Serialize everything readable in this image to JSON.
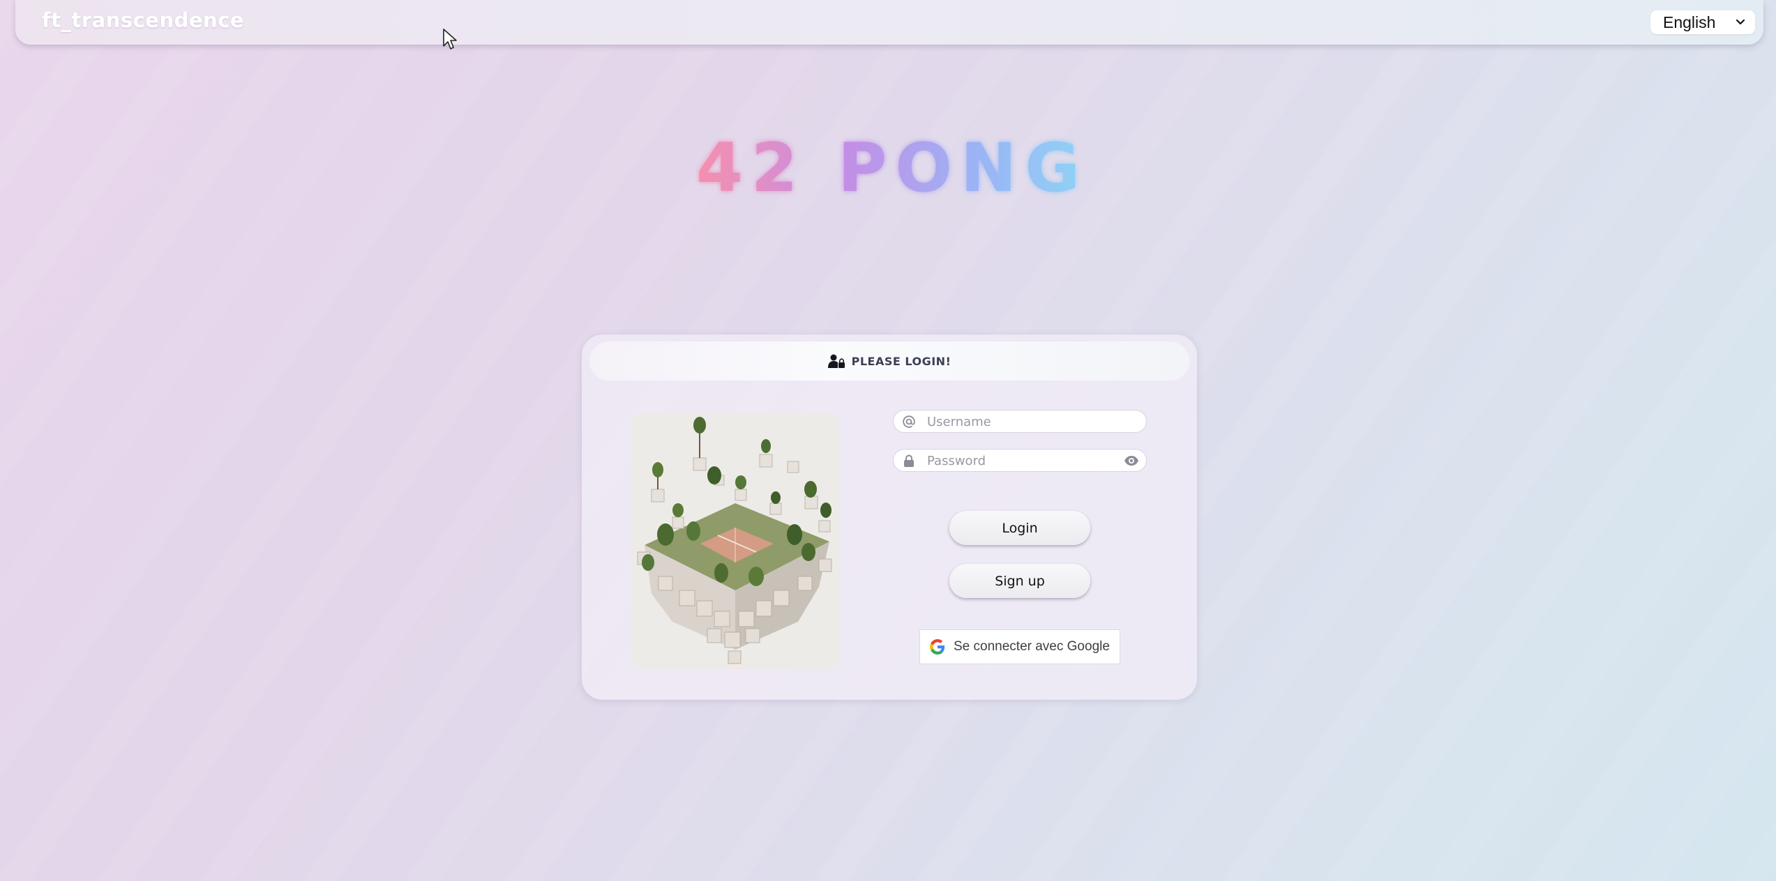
{
  "navbar": {
    "brand": "ft_transcendence",
    "language": {
      "selected": "English"
    }
  },
  "hero": {
    "title": "42 PONG",
    "title_colors": [
      "#f68fae",
      "#c38ee6",
      "#9bb4f5",
      "#8fd3f5"
    ]
  },
  "login_card": {
    "header_icon": "user-lock-icon",
    "header": "PLEASE LOGIN!",
    "image": "floating-cube-island-with-trees-and-court",
    "username": {
      "icon": "at-sign-icon",
      "placeholder": "Username",
      "value": ""
    },
    "password": {
      "icon": "lock-icon",
      "placeholder": "Password",
      "value": "",
      "toggle_icon": "eye-icon"
    },
    "login_label": "Login",
    "signup_label": "Sign up",
    "google_label": "Se connecter avec Google",
    "google_icon": "google-g-icon"
  },
  "colors": {
    "page_bg_left": "#e9d7ec",
    "page_bg_right": "#d5e6ef",
    "header_text": "#3a3f55"
  }
}
